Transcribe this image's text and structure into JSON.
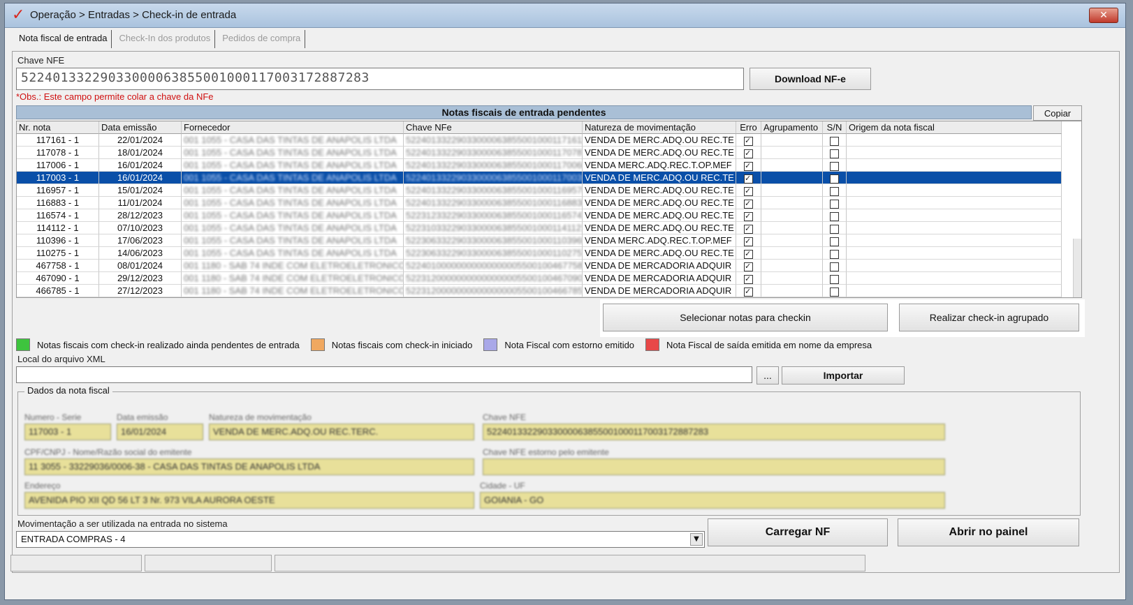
{
  "window": {
    "title": "Operação > Entradas > Check-in de entrada",
    "close_glyph": "✕"
  },
  "tabs": [
    "Nota fiscal de entrada",
    "Check-In dos produtos",
    "Pedidos de compra"
  ],
  "nfe": {
    "label": "Chave NFE",
    "value": "52240133229033000063855001000117003172887283",
    "download_label": "Download NF-e",
    "obs": "*Obs.: Este campo permite colar a chave da NFe"
  },
  "grid": {
    "title": "Notas fiscais de entrada pendentes",
    "copy_label": "Copiar",
    "headers": [
      "Nr. nota",
      "Data emissão",
      "Fornecedor",
      "Chave NFe",
      "Natureza de movimentação",
      "Erro",
      "Agrupamento",
      "S/N",
      "Origem da nota fiscal"
    ],
    "rows": [
      {
        "nr": "117161 - 1",
        "date": "22/01/2024",
        "supplier": "001 1055 - CASA DAS TINTAS DE ANAPOLIS LTDA",
        "key": "5224013322903300006385500100011716117",
        "nature": "VENDA DE MERC.ADQ.OU REC.TE",
        "err": true,
        "sn": false
      },
      {
        "nr": "117078 - 1",
        "date": "18/01/2024",
        "supplier": "001 1055 - CASA DAS TINTAS DE ANAPOLIS LTDA",
        "key": "5224013322903300006385500100011707872",
        "nature": "VENDA DE MERC.ADQ.OU REC.TE",
        "err": true,
        "sn": false
      },
      {
        "nr": "117006 - 1",
        "date": "16/01/2024",
        "supplier": "001 1055 - CASA DAS TINTAS DE ANAPOLIS LTDA",
        "key": "5224013322903300006385500100011700666",
        "nature": "VENDA MERC.ADQ.REC.T.OP.MEF",
        "err": true,
        "sn": false
      },
      {
        "nr": "117003 - 1",
        "date": "16/01/2024",
        "supplier": "001 1055 - CASA DAS TINTAS DE ANAPOLIS LTDA",
        "key": "5224013322903300006385500100011700317",
        "nature": "VENDA DE MERC.ADQ.OU REC.TE",
        "err": true,
        "sn": false
      },
      {
        "nr": "116957 - 1",
        "date": "15/01/2024",
        "supplier": "001 1055 - CASA DAS TINTAS DE ANAPOLIS LTDA",
        "key": "5224013322903300006385500100011695787",
        "nature": "VENDA DE MERC.ADQ.OU REC.TE",
        "err": true,
        "sn": false
      },
      {
        "nr": "116883 - 1",
        "date": "11/01/2024",
        "supplier": "001 1055 - CASA DAS TINTAS DE ANAPOLIS LTDA",
        "key": "5224013322903300006385500100011688388",
        "nature": "VENDA DE MERC.ADQ.OU REC.TE",
        "err": true,
        "sn": false
      },
      {
        "nr": "116574 - 1",
        "date": "28/12/2023",
        "supplier": "001 1055 - CASA DAS TINTAS DE ANAPOLIS LTDA",
        "key": "5223123322903300006385500100011657474",
        "nature": "VENDA DE MERC.ADQ.OU REC.TE",
        "err": true,
        "sn": false
      },
      {
        "nr": "114112 - 1",
        "date": "07/10/2023",
        "supplier": "001 1055 - CASA DAS TINTAS DE ANAPOLIS LTDA",
        "key": "5223103322903300006385500100011411217",
        "nature": "VENDA DE MERC.ADQ.OU REC.TE",
        "err": true,
        "sn": false
      },
      {
        "nr": "110396 - 1",
        "date": "17/06/2023",
        "supplier": "001 1055 - CASA DAS TINTAS DE ANAPOLIS LTDA",
        "key": "5223063322903300006385500100011039696",
        "nature": "VENDA MERC.ADQ.REC.T.OP.MEF",
        "err": true,
        "sn": false
      },
      {
        "nr": "110275 - 1",
        "date": "14/06/2023",
        "supplier": "001 1055 - CASA DAS TINTAS DE ANAPOLIS LTDA",
        "key": "5223063322903300006385500100011027575",
        "nature": "VENDA DE MERC.ADQ.OU REC.TE",
        "err": true,
        "sn": false
      },
      {
        "nr": "467758 - 1",
        "date": "08/01/2024",
        "supplier": "001 1180 - SAB 74 INDE COM ELETROELETRONICOS",
        "key": "5224010000000000000000550010046775877",
        "nature": "VENDA DE MERCADORIA ADQUIR",
        "err": true,
        "sn": false
      },
      {
        "nr": "467090 - 1",
        "date": "29/12/2023",
        "supplier": "001 1180 - SAB 74 INDE COM ELETROELETRONICOS",
        "key": "5223120000000000000000550010046709079",
        "nature": "VENDA DE MERCADORIA ADQUIR",
        "err": true,
        "sn": false
      },
      {
        "nr": "466785 - 1",
        "date": "27/12/2023",
        "supplier": "001 1180 - SAB 74 INDE COM ELETROELETRONICOS",
        "key": "5223120000000000000000550010046678578",
        "nature": "VENDA DE MERCADORIA ADQUIR",
        "err": true,
        "sn": false
      }
    ],
    "selected_row": 3
  },
  "actions": {
    "select_label": "Selecionar notas para checkin",
    "grouped_label": "Realizar check-in agrupado"
  },
  "legend": [
    {
      "color": "#3ec43e",
      "label": "Notas fiscais com check-in realizado ainda pendentes de entrada"
    },
    {
      "color": "#f0a860",
      "label": "Notas fiscais com check-in iniciado"
    },
    {
      "color": "#a9a8e8",
      "label": "Nota Fiscal com estorno emitido"
    },
    {
      "color": "#e84848",
      "label": "Nota Fiscal de saída emitida em nome da empresa"
    }
  ],
  "xml": {
    "label": "Local do arquivo XML",
    "browse_label": "...",
    "import_label": "Importar"
  },
  "details": {
    "title": "Dados da nota fiscal",
    "numero_label": "Numero - Serie",
    "numero_value": "117003 - 1",
    "data_label": "Data emissão",
    "data_value": "16/01/2024",
    "natureza_label": "Natureza de movimentação",
    "natureza_value": "VENDA DE MERC.ADQ.OU REC.TERC.",
    "chave_label": "Chave NFE",
    "chave_value": "52240133229033000063855001000117003172887283",
    "cpf_label": "CPF/CNPJ - Nome/Razão social do emitente",
    "cpf_value": "11 3055  -  33229036/0006-38 - CASA DAS TINTAS DE ANAPOLIS LTDA",
    "estorno_label": "Chave NFE estorno pelo emitente",
    "estorno_value": "",
    "endereco_label": "Endereço",
    "endereco_value": "AVENIDA PIO XII QD 56 LT 3 Nr. 973 VILA AURORA OESTE",
    "cidade_label": "Cidade - UF",
    "cidade_value": "GOIANIA - GO"
  },
  "movement": {
    "label": "Movimentação a ser utilizada na entrada no sistema",
    "value": "ENTRADA COMPRAS - 4",
    "load_label": "Carregar NF",
    "open_label": "Abrir no painel"
  }
}
